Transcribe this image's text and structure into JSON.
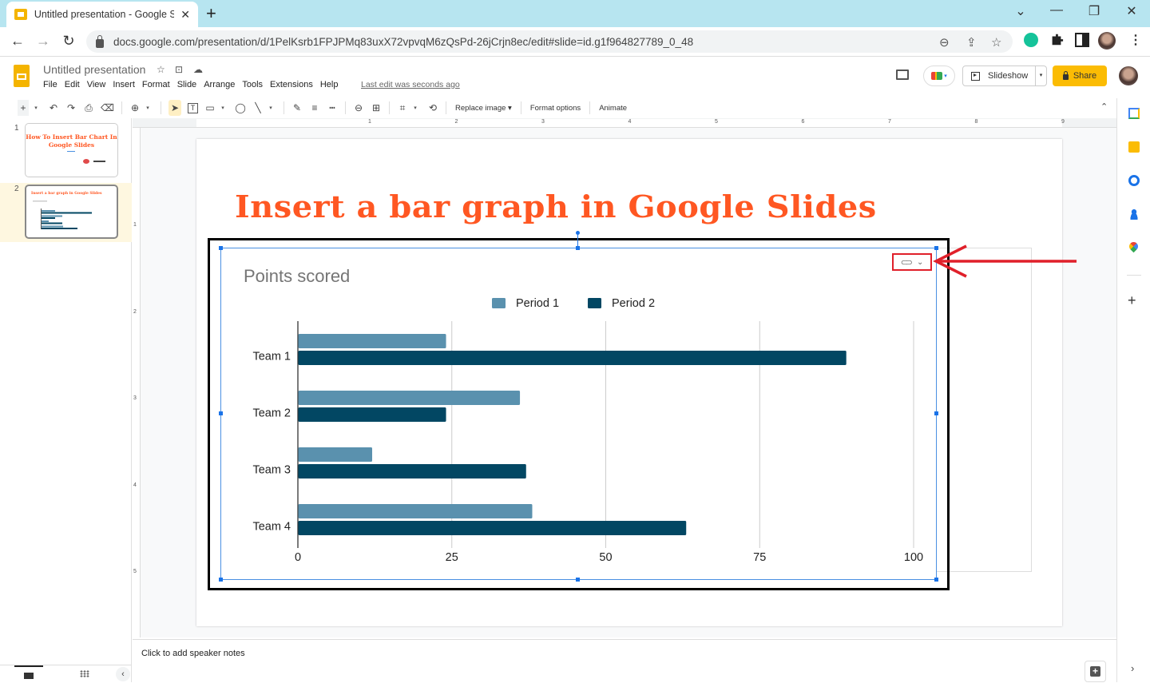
{
  "browser": {
    "tab_title": "Untitled presentation - Google Sl",
    "tab_close": "✕",
    "new_tab": "+",
    "window_controls": {
      "tab_search": "⌄",
      "minimize": "—",
      "restore": "❐",
      "close": "✕"
    },
    "nav": {
      "back": "←",
      "forward": "→",
      "reload": "↻"
    },
    "url": "docs.google.com/presentation/d/1PelKsrb1FPJPMq83uxX72vpvqM6zQsPd-26jCrjn8ec/edit#slide=id.g1f964827789_0_48",
    "omnibox_icons": [
      "zoom-out-icon",
      "share-icon",
      "bookmark-star-icon"
    ],
    "extensions": [
      "grammarly-icon",
      "extensions-puzzle-icon",
      "side-panel-icon",
      "profile-avatar",
      "chrome-menu-icon"
    ],
    "menu_glyph": "⋮",
    "zoom_glyph": "⊖",
    "share_glyph": "⇪",
    "star_glyph": "☆"
  },
  "docs": {
    "title": "Untitled presentation",
    "title_icons": {
      "star": "☆",
      "move": "⊡",
      "cloud": "☁"
    },
    "menu": [
      "File",
      "Edit",
      "View",
      "Insert",
      "Format",
      "Slide",
      "Arrange",
      "Tools",
      "Extensions",
      "Help"
    ],
    "last_edit": "Last edit was seconds ago",
    "slideshow_label": "Slideshow",
    "slideshow_dropdown": "▾",
    "share_label": "Share",
    "meet_dropdown": "▾"
  },
  "toolbar": {
    "new_slide": "+",
    "dropdown": "▾",
    "undo": "↶",
    "redo": "↷",
    "print": "⎙",
    "paint_format": "⌫",
    "zoom": "⊕",
    "select": "➤",
    "textbox": "T",
    "image": "▭",
    "shape": "◯",
    "line": "╲",
    "pen": "✎",
    "border_weight": "≡",
    "border_dash": "┅",
    "link": "⊖",
    "comment": "⊞",
    "crop": "⌗",
    "reset_image": "⟲",
    "replace_image": "Replace image ▾",
    "format_options": "Format options",
    "animate": "Animate",
    "collapse": "⌃"
  },
  "filmstrip": {
    "slides": [
      {
        "number": "1",
        "title": "How To Insert Bar Chart In Google Slides"
      },
      {
        "number": "2",
        "title": "Insert a bar graph in Google Slides"
      }
    ],
    "selected_slide": 2,
    "collapse_glyph": "‹"
  },
  "rulers": {
    "horizontal": [
      "1",
      "2",
      "3",
      "4",
      "5",
      "6",
      "7",
      "8",
      "9"
    ],
    "vertical": [
      "1",
      "2",
      "3",
      "4",
      "5"
    ]
  },
  "slide": {
    "title": "Insert a bar graph in Google Slides",
    "linked_chart_options": {
      "link_glyph": "⊂⊃",
      "chevron": "⌄"
    }
  },
  "chart_data": {
    "type": "bar",
    "orientation": "horizontal",
    "title": "Points scored",
    "categories": [
      "Team 1",
      "Team 2",
      "Team 3",
      "Team 4"
    ],
    "series": [
      {
        "name": "Period 1",
        "color": "#5a91ae",
        "values": [
          24,
          36,
          12,
          38
        ]
      },
      {
        "name": "Period 2",
        "color": "#024763",
        "values": [
          89,
          24,
          37,
          63
        ]
      }
    ],
    "xlabel": "",
    "ylabel": "",
    "xlim": [
      0,
      100
    ],
    "xticks": [
      0,
      25,
      50,
      75,
      100
    ],
    "grid": true,
    "legend": "top-center"
  },
  "notes": {
    "placeholder": "Click to add speaker notes",
    "explore_glyph": "+"
  },
  "side_panel": {
    "items": [
      "calendar-icon",
      "keep-icon",
      "tasks-icon",
      "contacts-icon",
      "maps-icon"
    ],
    "add_glyph": "+",
    "expand_glyph": "›"
  },
  "colors": {
    "accent_title": "#ff5722",
    "share_button": "#fbbc04",
    "selection_blue": "#1a73e8",
    "annotation_red": "#e0202a"
  }
}
